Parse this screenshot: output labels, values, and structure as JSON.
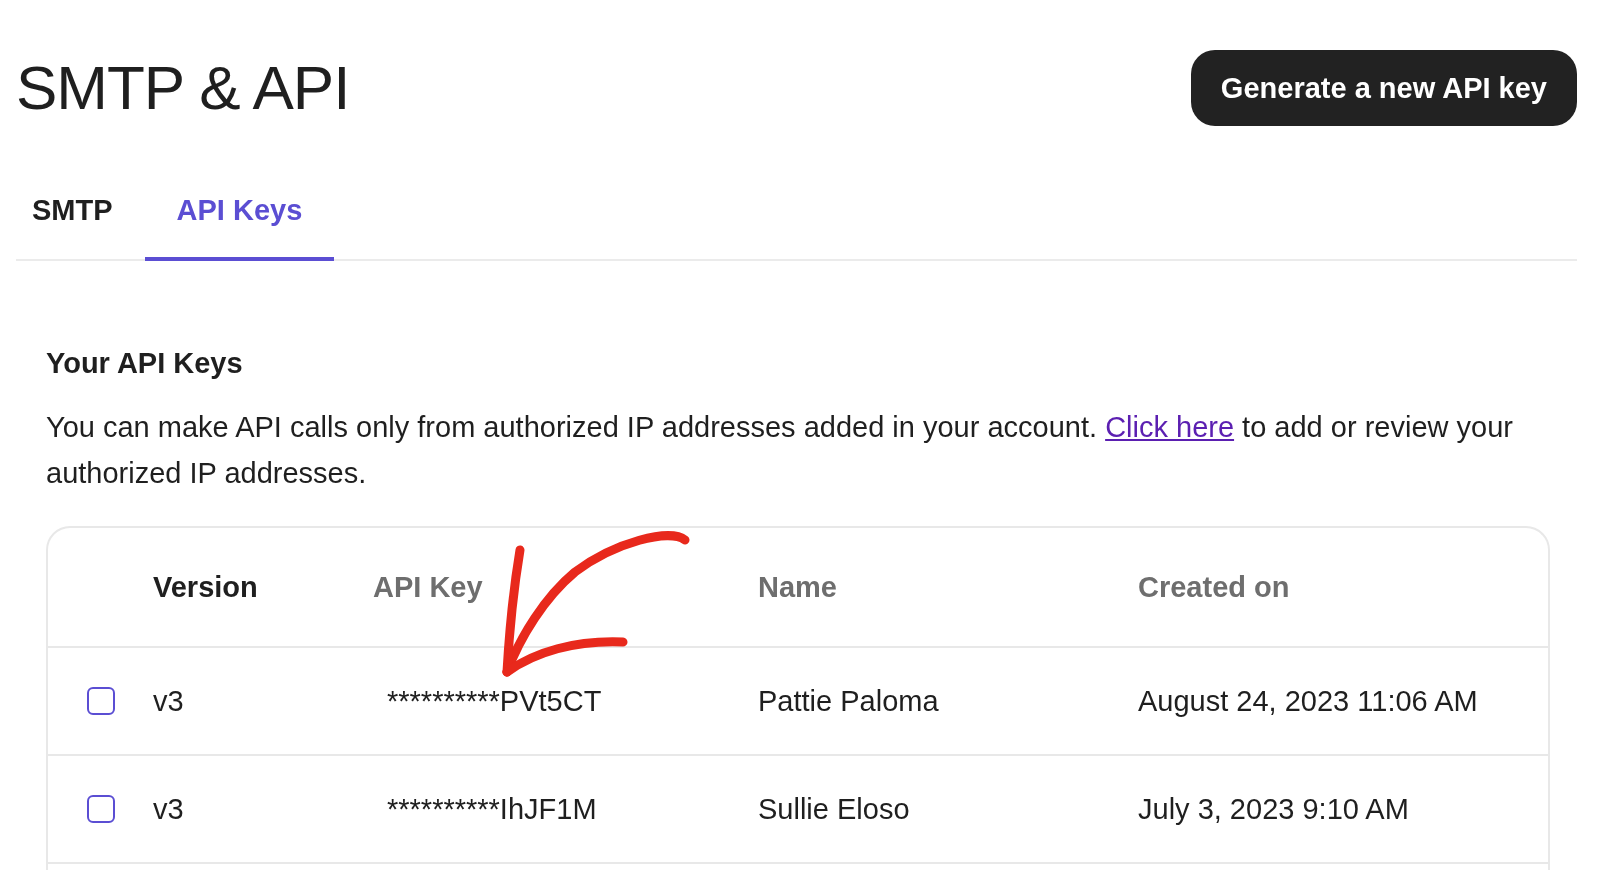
{
  "page": {
    "title": "SMTP & API"
  },
  "header_button": {
    "label": "Generate a new API key"
  },
  "tabs": [
    {
      "label": "SMTP",
      "selected": false
    },
    {
      "label": "API Keys",
      "selected": true
    }
  ],
  "section": {
    "heading": "Your API Keys",
    "text_before": "You can make API calls only from authorized IP addresses added in your account.",
    "link": "Click here",
    "text_after": "to add or review your authorized IP addresses."
  },
  "table": {
    "columns": [
      {
        "label": "Version",
        "active": true
      },
      {
        "label": "API Key",
        "active": false
      },
      {
        "label": "Name",
        "active": false
      },
      {
        "label": "Created on",
        "active": false
      }
    ],
    "rows": [
      {
        "checked": false,
        "version": "v3",
        "api_key": "**********PVt5CT",
        "name": "Pattie Paloma",
        "created_on": "August 24, 2023 11:06 AM"
      },
      {
        "checked": false,
        "version": "v3",
        "api_key": "**********IhJF1M",
        "name": "Sullie Eloso",
        "created_on": "July 3, 2023 9:10 AM"
      }
    ]
  }
}
